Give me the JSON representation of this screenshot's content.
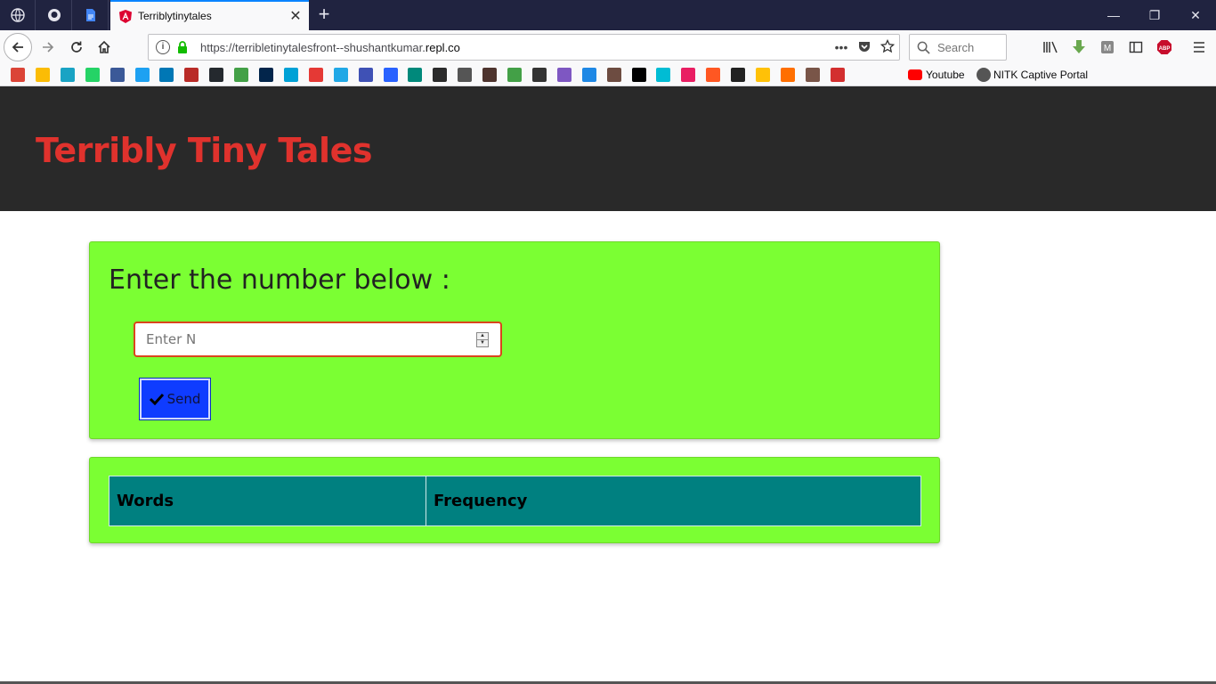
{
  "browser": {
    "active_tab_title": "Terriblytinytales",
    "url_prefix": "https://terribletinytalesfront--shushantkumar.",
    "url_domain": "repl.co",
    "url_actions_label": "•••",
    "search_placeholder": "Search",
    "window_controls": {
      "minimize": "—",
      "restore": "❐",
      "close": "✕"
    },
    "newtab_label": "+",
    "tab_close_label": "✕"
  },
  "bookmarks": {
    "youtube_label": "Youtube",
    "nitk_label": "NITK Captive Portal",
    "icon_colors": [
      "#db4437",
      "#fbbc05",
      "#19a3c4",
      "#25d366",
      "#3b5998",
      "#1da1f2",
      "#0077b5",
      "#b92b27",
      "#24292e",
      "#43a047",
      "#02254b",
      "#00a1d6",
      "#e53935",
      "#21a8e6",
      "#3f51b5",
      "#2962ff",
      "#00897b",
      "#2b2b2b",
      "#555555",
      "#4e342e",
      "#43a047",
      "#333333",
      "#7e57c2",
      "#1e88e5",
      "#6d4c41",
      "#000000",
      "#00bcd4",
      "#e91e63",
      "#ff5722",
      "#222222",
      "#ffc107",
      "#ff6f00",
      "#795548",
      "#d32f2f"
    ]
  },
  "page": {
    "site_title": "Terribly Tiny Tales",
    "prompt": "Enter the number below :",
    "input_placeholder": "Enter N",
    "send_label": "Send",
    "table": {
      "headers": [
        "Words",
        "Frequency"
      ]
    }
  },
  "colors": {
    "header_bg": "#292929",
    "title_red": "#e0322d",
    "card_green": "#7bff33",
    "send_blue": "#0f3cff",
    "table_teal": "#008080"
  }
}
